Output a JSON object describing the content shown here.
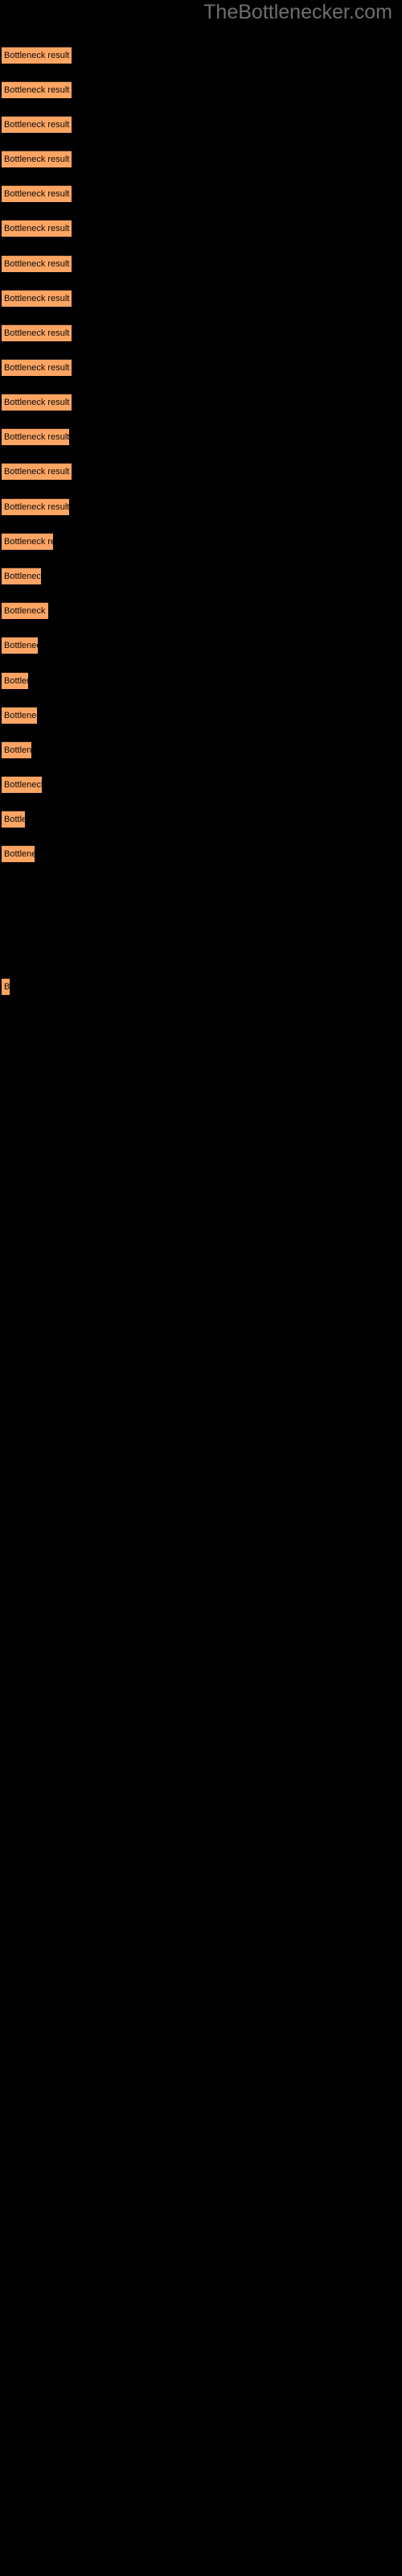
{
  "site": {
    "watermark": "TheBottlenecker.com"
  },
  "colors": {
    "background": "#000000",
    "bar_fill": "#ffa563",
    "bar_border": "#3d2a1b",
    "bar_label_text": "#0a0a0a",
    "watermark_text": "#6e6e6e"
  },
  "chart_data": {
    "type": "bar",
    "orientation": "horizontal",
    "title": "",
    "subtitle": "",
    "xlabel": "",
    "ylabel": "",
    "grid": false,
    "legend": false,
    "bar_label_text": "Bottleneck result",
    "categories": [
      "Bottleneck result",
      "Bottleneck result",
      "Bottleneck result",
      "Bottleneck result",
      "Bottleneck result",
      "Bottleneck result",
      "Bottleneck result",
      "Bottleneck result",
      "Bottleneck result",
      "Bottleneck result",
      "Bottleneck result",
      "Bottleneck result",
      "Bottleneck result",
      "Bottleneck result",
      "Bottleneck result",
      "Bottleneck result",
      "Bottleneck result",
      "Bottleneck result",
      "Bottleneck result",
      "Bottleneck result",
      "Bottleneck result",
      "Bottleneck result",
      "Bottleneck result",
      "Bottleneck result",
      "Bottleneck result",
      "Bottleneck result"
    ],
    "values": [
      87,
      87,
      87,
      87,
      87,
      87,
      87,
      87,
      87,
      87,
      87,
      87,
      87,
      64,
      49,
      58,
      45,
      33,
      44,
      37,
      50,
      29,
      41,
      10
    ],
    "xlim": [
      0,
      500
    ],
    "bars": [
      {
        "index": 1,
        "y": 58,
        "width": 87,
        "label": "Bottleneck result"
      },
      {
        "index": 2,
        "y": 101,
        "width": 87,
        "label": "Bottleneck result"
      },
      {
        "index": 3,
        "y": 144,
        "width": 87,
        "label": "Bottleneck result"
      },
      {
        "index": 4,
        "y": 187,
        "width": 87,
        "label": "Bottleneck result"
      },
      {
        "index": 5,
        "y": 230,
        "width": 87,
        "label": "Bottleneck result"
      },
      {
        "index": 6,
        "y": 273,
        "width": 87,
        "label": "Bottleneck result"
      },
      {
        "index": 7,
        "y": 317,
        "width": 87,
        "label": "Bottleneck result"
      },
      {
        "index": 8,
        "y": 360,
        "width": 87,
        "label": "Bottleneck result"
      },
      {
        "index": 9,
        "y": 403,
        "width": 87,
        "label": "Bottleneck result"
      },
      {
        "index": 10,
        "y": 446,
        "width": 87,
        "label": "Bottleneck result"
      },
      {
        "index": 11,
        "y": 489,
        "width": 87,
        "label": "Bottleneck result"
      },
      {
        "index": 12,
        "y": 532,
        "width": 84,
        "label": "Bottleneck result"
      },
      {
        "index": 13,
        "y": 575,
        "width": 87,
        "label": "Bottleneck result"
      },
      {
        "index": 14,
        "y": 619,
        "width": 84,
        "label": "Bottleneck result"
      },
      {
        "index": 15,
        "y": 662,
        "width": 64,
        "label": "Bottleneck resu"
      },
      {
        "index": 16,
        "y": 705,
        "width": 49,
        "label": "Bottleneck"
      },
      {
        "index": 17,
        "y": 748,
        "width": 58,
        "label": "Bottleneck re"
      },
      {
        "index": 18,
        "y": 791,
        "width": 45,
        "label": "Bottlenec"
      },
      {
        "index": 19,
        "y": 835,
        "width": 33,
        "label": "Bottl"
      },
      {
        "index": 20,
        "y": 878,
        "width": 44,
        "label": "Bottlene"
      },
      {
        "index": 21,
        "y": 921,
        "width": 37,
        "label": "Bottlen"
      },
      {
        "index": 22,
        "y": 964,
        "width": 50,
        "label": "Bottleneck"
      },
      {
        "index": 23,
        "y": 1007,
        "width": 29,
        "label": "Bott"
      },
      {
        "index": 24,
        "y": 1050,
        "width": 41,
        "label": "Bottlene"
      },
      {
        "index": 25,
        "y": 1215,
        "width": 10,
        "label": "B"
      }
    ]
  }
}
